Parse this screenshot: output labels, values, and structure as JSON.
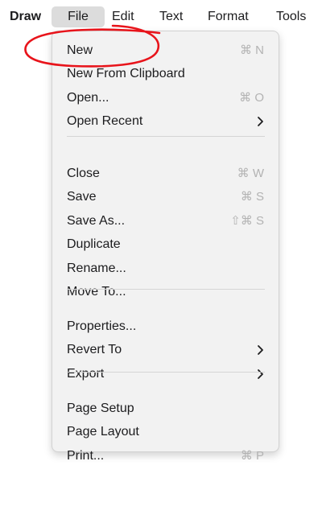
{
  "menubar": {
    "app_name": "Draw",
    "items": [
      "File",
      "Edit",
      "Text",
      "Format",
      "Tools"
    ]
  },
  "menu": {
    "groups": [
      [
        {
          "label": "New",
          "shortcut": "⌘ N",
          "submenu": false
        },
        {
          "label": "New From Clipboard",
          "shortcut": "",
          "submenu": false
        },
        {
          "label": "Open...",
          "shortcut": "⌘ O",
          "submenu": false
        },
        {
          "label": "Open Recent",
          "shortcut": "",
          "submenu": true
        }
      ],
      [
        {
          "label": "Close",
          "shortcut": "⌘ W",
          "submenu": false
        },
        {
          "label": "Save",
          "shortcut": "⌘ S",
          "submenu": false
        },
        {
          "label": "Save As...",
          "shortcut": "⇧⌘ S",
          "submenu": false
        },
        {
          "label": "Duplicate",
          "shortcut": "",
          "submenu": false
        },
        {
          "label": "Rename...",
          "shortcut": "",
          "submenu": false
        },
        {
          "label": "Move To...",
          "shortcut": "",
          "submenu": false
        }
      ],
      [
        {
          "label": "Properties...",
          "shortcut": "",
          "submenu": false
        },
        {
          "label": "Revert To",
          "shortcut": "",
          "submenu": true
        },
        {
          "label": "Export",
          "shortcut": "",
          "submenu": true
        }
      ],
      [
        {
          "label": "Page Setup",
          "shortcut": "",
          "submenu": false
        },
        {
          "label": "Page Layout",
          "shortcut": "",
          "submenu": false
        },
        {
          "label": "Print...",
          "shortcut": "⌘ P",
          "submenu": false
        }
      ]
    ]
  },
  "annotation": {
    "color": "#e8141b",
    "target": "New"
  },
  "colors": {
    "menu_bg": "#f2f2f2",
    "highlight": "#dcdcdc",
    "shortcut": "#b3b3b3"
  }
}
